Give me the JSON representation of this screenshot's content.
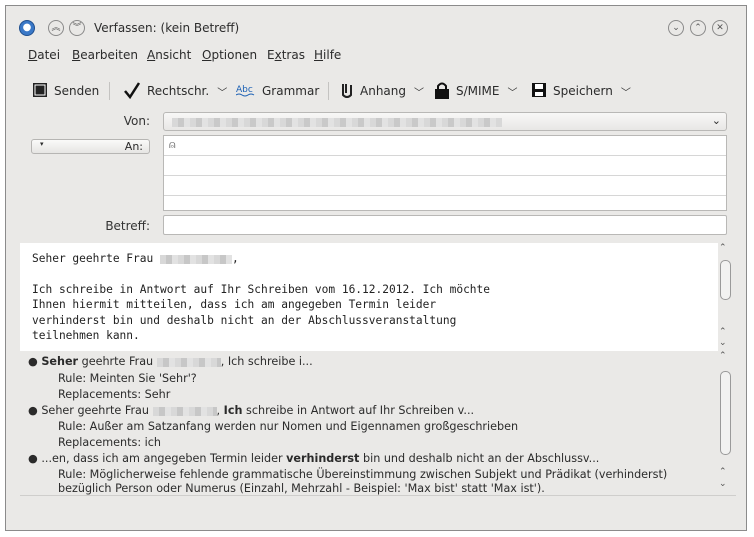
{
  "window": {
    "title": "Verfassen: (kein Betreff)"
  },
  "menu": [
    "Datei",
    "Bearbeiten",
    "Ansicht",
    "Optionen",
    "Extras",
    "Hilfe"
  ],
  "toolbar": {
    "send": "Senden",
    "spell": "Rechtschr.",
    "grammar": "Grammar",
    "attach": "Anhang",
    "smime": "S/MIME",
    "save": "Speichern"
  },
  "header": {
    "from_label": "Von:",
    "to_label": "An:",
    "subject_label": "Betreff:",
    "subject_value": ""
  },
  "body_lines": [
    "Seher geehrte Frau ",
    "",
    "Ich schreibe in Antwort auf Ihr Schreiben vom 16.12.2012. Ich möchte",
    "Ihnen hiermit mitteilen, dass ich am angegeben Termin leider",
    "verhinderst bin und deshalb nicht an der Abschlussveranstaltung",
    "teilnehmen kann."
  ],
  "body_comma": ",",
  "spell_results": [
    {
      "pre": "",
      "bold": "Seher",
      "mid": " geehrte Frau ",
      "post": ", Ich schreibe i...",
      "blur_after_mid": true,
      "rule": "Rule: Meinten Sie 'Sehr'?",
      "replacements": "Replacements: Sehr"
    },
    {
      "pre": "Seher geehrte Frau ",
      "bold": "Ich",
      "mid": "",
      "post": " schreibe in Antwort auf Ihr Schreiben v...",
      "blur_after_mid": false,
      "rule": "Rule: Außer am Satzanfang werden nur Nomen und Eigennamen großgeschrieben",
      "replacements": "Replacements: ich"
    },
    {
      "pre": "...en, dass ich am angegeben Termin leider ",
      "bold": "verhinderst",
      "mid": "",
      "post": " bin und deshalb nicht an der Abschlussv...",
      "blur_after_mid": false,
      "rule": "Rule: Möglicherweise fehlende grammatische Übereinstimmung zwischen Subjekt und Prädikat (verhinderst)",
      "rule2": "bezüglich Person oder Numerus (Einzahl, Mehrzahl - Beispiel: 'Max bist' statt 'Max ist')."
    }
  ]
}
